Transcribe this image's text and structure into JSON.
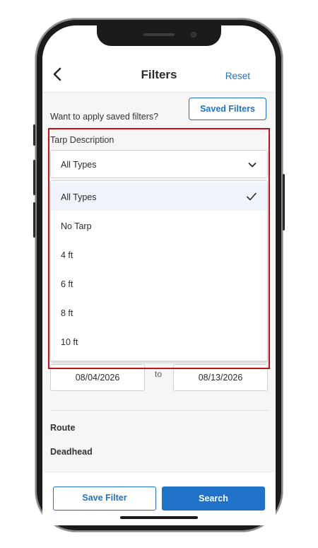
{
  "header": {
    "title": "Filters",
    "reset_label": "Reset"
  },
  "saved_filters": {
    "prompt": "Want to apply saved filters?",
    "button_label": "Saved Filters"
  },
  "tarp": {
    "label": "Tarp Description",
    "selected": "All Types",
    "options": [
      "All Types",
      "No Tarp",
      "4 ft",
      "6 ft",
      "8 ft",
      "10 ft"
    ]
  },
  "dates": {
    "start": "08/04/2026",
    "separator": "to",
    "end": "08/13/2026"
  },
  "sections": {
    "route": "Route",
    "deadhead": "Deadhead"
  },
  "bottom": {
    "save_filter_label": "Save Filter",
    "search_label": "Search"
  },
  "colors": {
    "accent": "#1f72c8",
    "highlight": "#c0141c",
    "selected_bg": "#eef4fa"
  },
  "icons": {
    "back": "chevron-left-icon",
    "dropdown": "chevron-down-icon",
    "selected": "check-icon"
  }
}
